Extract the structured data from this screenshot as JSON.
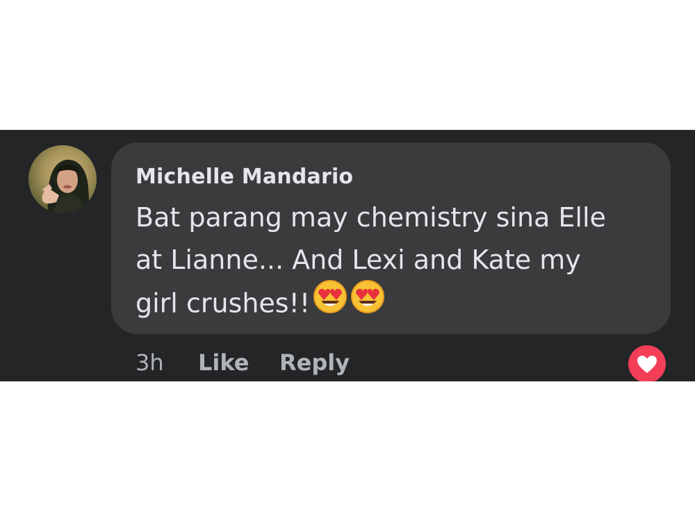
{
  "comment": {
    "author": "Michelle Mandario",
    "lines": [
      "Bat parang may chemistry sina Elle",
      "at Lianne... And Lexi and Kate my",
      "girl crushes!!"
    ],
    "emojis": [
      "heart-eyes-emoji",
      "heart-eyes-emoji"
    ]
  },
  "actions": {
    "timestamp": "3h",
    "like_label": "Like",
    "reply_label": "Reply"
  },
  "reaction": {
    "icon": "heart-icon",
    "color": "#f33e58"
  }
}
